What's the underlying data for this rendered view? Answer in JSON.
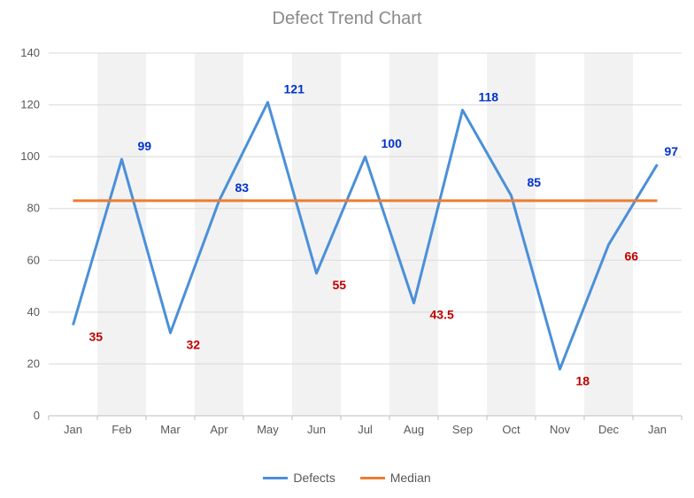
{
  "title": "Defect Trend Chart",
  "legend": {
    "defects": "Defects",
    "median": "Median"
  },
  "colors": {
    "defects": "#4a90d9",
    "median": "#ed7d31",
    "lo": "#c00000",
    "hi": "#0033cc"
  },
  "chart_data": {
    "type": "line",
    "categories": [
      "Jan",
      "Feb",
      "Mar",
      "Apr",
      "May",
      "Jun",
      "Jul",
      "Aug",
      "Sep",
      "Oct",
      "Nov",
      "Dec",
      "Jan"
    ],
    "series": [
      {
        "name": "Defects",
        "values": [
          35,
          99,
          32,
          83,
          121,
          55,
          100,
          43.5,
          118,
          85,
          18,
          66,
          97
        ]
      },
      {
        "name": "Median",
        "values": [
          83,
          83,
          83,
          83,
          83,
          83,
          83,
          83,
          83,
          83,
          83,
          83,
          83
        ]
      }
    ],
    "labels": [
      {
        "i": 0,
        "text": "35",
        "pos": "lo"
      },
      {
        "i": 1,
        "text": "99",
        "pos": "hi"
      },
      {
        "i": 2,
        "text": "32",
        "pos": "lo"
      },
      {
        "i": 3,
        "text": "83",
        "pos": "hi"
      },
      {
        "i": 4,
        "text": "121",
        "pos": "hi"
      },
      {
        "i": 5,
        "text": "55",
        "pos": "lo"
      },
      {
        "i": 6,
        "text": "100",
        "pos": "hi"
      },
      {
        "i": 7,
        "text": "43.5",
        "pos": "lo"
      },
      {
        "i": 8,
        "text": "118",
        "pos": "hi"
      },
      {
        "i": 9,
        "text": "85",
        "pos": "hi"
      },
      {
        "i": 10,
        "text": "18",
        "pos": "lo"
      },
      {
        "i": 11,
        "text": "66",
        "pos": "lo"
      },
      {
        "i": 12,
        "text": "97",
        "pos": "hi"
      }
    ],
    "ylim": [
      0,
      140
    ],
    "yticks": [
      0,
      20,
      40,
      60,
      80,
      100,
      120,
      140
    ],
    "title": "Defect Trend Chart",
    "xlabel": "",
    "ylabel": ""
  }
}
